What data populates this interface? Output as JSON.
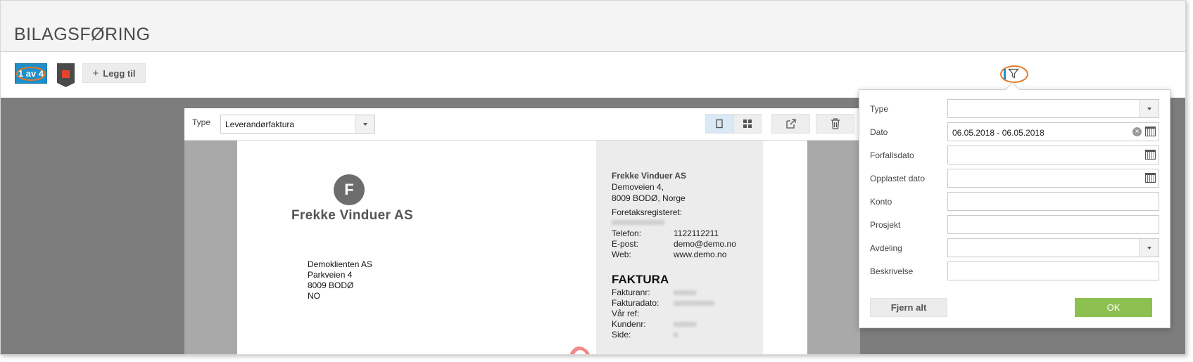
{
  "page": {
    "title": "BILAGSFØRING"
  },
  "toolbar": {
    "counter": "1 av 4",
    "add_label": "Legg til"
  },
  "viewer": {
    "type_label": "Type",
    "type_value": "Leverandørfaktura",
    "document": {
      "logo_letter": "F",
      "company_name": "Frekke Vinduer AS",
      "recipient": [
        "Demoklienten AS",
        "Parkveien 4",
        "8009 BODØ",
        "NO"
      ],
      "sender_name": "Frekke Vinduer AS",
      "sender_address": [
        "Demoveien 4,",
        "8009 BODØ, Norge"
      ],
      "register_label": "Foretaksregisteret:",
      "contacts": [
        {
          "label": "Telefon:",
          "value": "1122112211"
        },
        {
          "label": "E-post:",
          "value": "demo@demo.no"
        },
        {
          "label": "Web:",
          "value": "www.demo.no"
        }
      ],
      "invoice_heading": "FAKTURA",
      "invoice_fields": [
        "Fakturanr:",
        "Fakturadato:",
        "Vår ref:",
        "Kundenr:",
        "Side:"
      ]
    }
  },
  "filter": {
    "fields": [
      {
        "label": "Type",
        "value": "",
        "kind": "select"
      },
      {
        "label": "Dato",
        "value": "06.05.2018 - 06.05.2018",
        "kind": "date-clear"
      },
      {
        "label": "Forfallsdato",
        "value": "",
        "kind": "date"
      },
      {
        "label": "Opplastet dato",
        "value": "",
        "kind": "date"
      },
      {
        "label": "Konto",
        "value": "",
        "kind": "text"
      },
      {
        "label": "Prosjekt",
        "value": "",
        "kind": "text"
      },
      {
        "label": "Avdeling",
        "value": "",
        "kind": "select"
      },
      {
        "label": "Beskrivelse",
        "value": "",
        "kind": "text"
      }
    ],
    "clear_label": "Fjern alt",
    "ok_label": "OK"
  },
  "colors": {
    "accent": "#1e8fca",
    "highlight": "#e87722",
    "ok": "#8cc152",
    "flag": "#e8432b"
  },
  "icons": [
    "plus-icon",
    "filter-icon",
    "single-page-icon",
    "grid-icon",
    "popout-icon",
    "trash-icon",
    "calendar-icon",
    "clear-icon",
    "chevron-down-icon"
  ]
}
